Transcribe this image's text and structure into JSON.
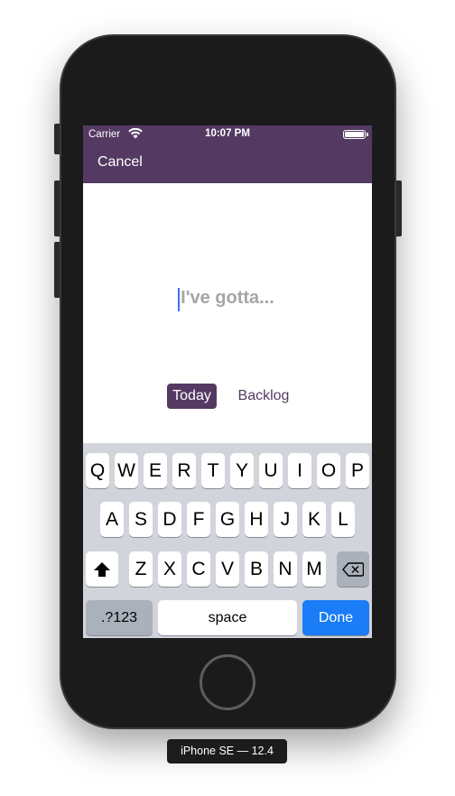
{
  "status_bar": {
    "carrier": "Carrier",
    "time": "10:07 PM"
  },
  "nav": {
    "cancel_label": "Cancel"
  },
  "task_input": {
    "value": "",
    "placeholder": "I've gotta..."
  },
  "list_selector": {
    "options": [
      "Today",
      "Backlog"
    ],
    "selected": "Today"
  },
  "keyboard": {
    "row1": [
      "Q",
      "W",
      "E",
      "R",
      "T",
      "Y",
      "U",
      "I",
      "O",
      "P"
    ],
    "row2": [
      "A",
      "S",
      "D",
      "F",
      "G",
      "H",
      "J",
      "K",
      "L"
    ],
    "row3": [
      "Z",
      "X",
      "C",
      "V",
      "B",
      "N",
      "M"
    ],
    "numbers_label": ".?123",
    "space_label": "space",
    "done_label": "Done"
  },
  "device_label": "iPhone SE — 12.4",
  "colors": {
    "accent": "#543a62",
    "done_blue": "#1a7cf6",
    "keyboard_bg": "#d1d4da",
    "placeholder": "#a6a6a6",
    "cursor": "#3f6ee8"
  }
}
